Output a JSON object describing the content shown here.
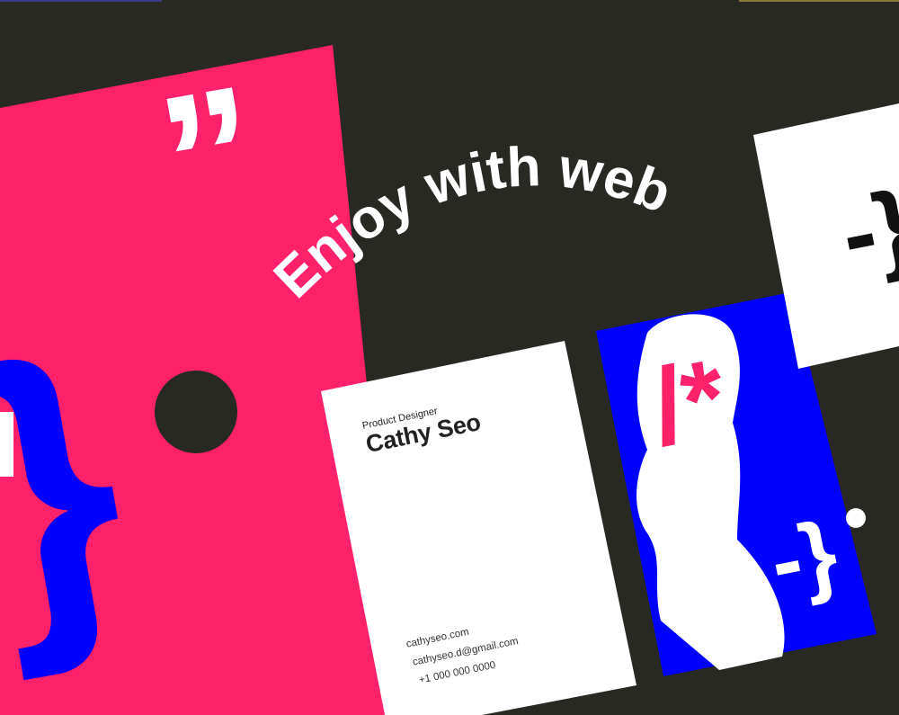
{
  "headline": "Enjoy with web",
  "card": {
    "role": "Product Designer",
    "name": "Cathy Seo",
    "website": "cathyseo.com",
    "email": "cathyseo.d@gmail.com",
    "phone": "+1 000 000 0000"
  },
  "colors": {
    "background": "#292924",
    "pink": "#FF2169",
    "blue": "#0000FF",
    "white": "#FFFFFF"
  }
}
